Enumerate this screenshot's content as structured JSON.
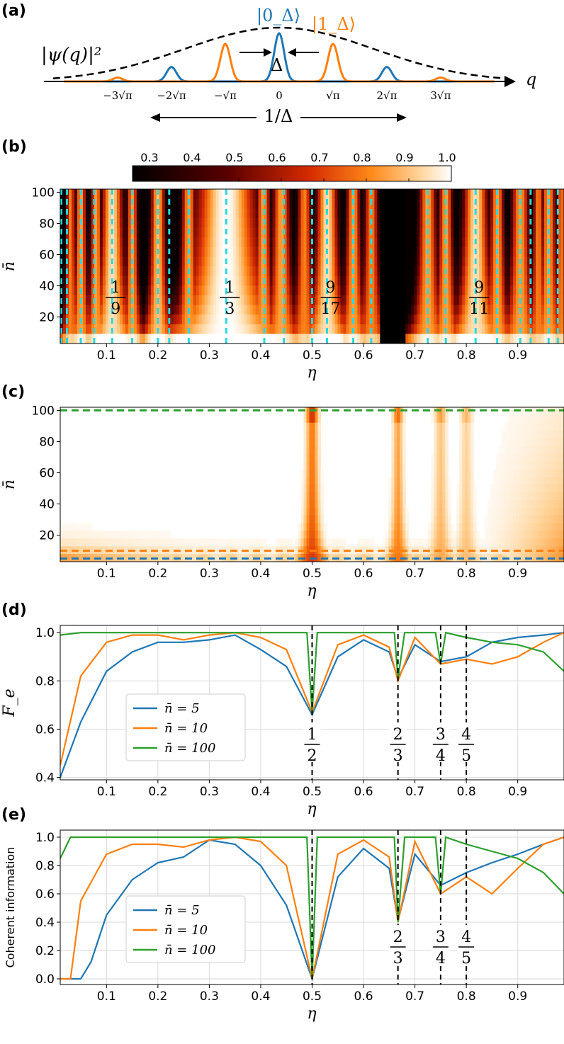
{
  "panels": {
    "a": {
      "label": "(a)",
      "y_label": "|ψ(q)|²",
      "axis_label": "q",
      "state0_label": "|0_Δ⟩",
      "state1_label": "|1_Δ⟩",
      "delta_label": "Δ",
      "width_label": "1/Δ",
      "ticks": [
        "−3√π",
        "−2√π",
        "−√π",
        "0",
        "√π",
        "2√π",
        "3√π"
      ],
      "colors": {
        "state0": "#1f77b4",
        "state1": "#ff7f0e",
        "envelope": "#000000"
      }
    },
    "b": {
      "label": "(b)",
      "colorbar_ticks": [
        "0.3",
        "0.4",
        "0.5",
        "0.6",
        "0.7",
        "0.8",
        "0.9",
        "1.0"
      ],
      "xlabel": "η",
      "ylabel": "n̄",
      "yticks": [
        "20",
        "40",
        "60",
        "80",
        "100"
      ],
      "xticks": [
        "0.1",
        "0.2",
        "0.3",
        "0.4",
        "0.5",
        "0.6",
        "0.7",
        "0.8",
        "0.9"
      ],
      "fractions": [
        {
          "num": "1",
          "den": "9",
          "eta": 0.111
        },
        {
          "num": "1",
          "den": "3",
          "eta": 0.333
        },
        {
          "num": "9",
          "den": "17",
          "eta": 0.529
        },
        {
          "num": "9",
          "den": "11",
          "eta": 0.818
        }
      ]
    },
    "c": {
      "label": "(c)",
      "xlabel": "η",
      "ylabel": "n̄",
      "yticks": [
        "20",
        "40",
        "60",
        "80",
        "100"
      ],
      "xticks": [
        "0.1",
        "0.2",
        "0.3",
        "0.4",
        "0.5",
        "0.6",
        "0.7",
        "0.8",
        "0.9"
      ],
      "hlines": [
        {
          "nbar": 100,
          "color": "#2ca02c"
        },
        {
          "nbar": 10,
          "color": "#ff7f0e"
        },
        {
          "nbar": 5,
          "color": "#1f77b4"
        }
      ]
    },
    "d": {
      "label": "(d)",
      "xlabel": "η",
      "ylabel": "F_e",
      "yticks": [
        "0.4",
        "0.6",
        "0.8",
        "1.0"
      ],
      "xticks": [
        "0.1",
        "0.2",
        "0.3",
        "0.4",
        "0.5",
        "0.6",
        "0.7",
        "0.8",
        "0.9"
      ],
      "legend": [
        "n̄ = 5",
        "n̄ = 10",
        "n̄ = 100"
      ],
      "fractions": [
        {
          "num": "1",
          "den": "2",
          "eta": 0.5
        },
        {
          "num": "2",
          "den": "3",
          "eta": 0.667
        },
        {
          "num": "3",
          "den": "4",
          "eta": 0.75
        },
        {
          "num": "4",
          "den": "5",
          "eta": 0.8
        }
      ]
    },
    "e": {
      "label": "(e)",
      "xlabel": "η",
      "ylabel": "Coherent information",
      "yticks": [
        "0.0",
        "0.2",
        "0.4",
        "0.6",
        "0.8",
        "1.0"
      ],
      "xticks": [
        "0.1",
        "0.2",
        "0.3",
        "0.4",
        "0.5",
        "0.6",
        "0.7",
        "0.8",
        "0.9"
      ],
      "legend": [
        "n̄ = 5",
        "n̄ = 10",
        "n̄ = 100"
      ],
      "fractions": [
        {
          "num": "2",
          "den": "3",
          "eta": 0.667
        },
        {
          "num": "3",
          "den": "4",
          "eta": 0.75
        },
        {
          "num": "4",
          "den": "5",
          "eta": 0.8
        }
      ]
    }
  },
  "series_colors": {
    "n5": "#1f77b4",
    "n10": "#ff7f0e",
    "n100": "#2ca02c"
  },
  "chart_data": [
    {
      "type": "line",
      "panel": "a",
      "title": "",
      "description_x": "q in units of √π",
      "series": [
        {
          "name": "|0_Δ⟩",
          "peaks_x": [
            -2,
            0,
            2
          ],
          "peak_heights": [
            0.3,
            1.0,
            0.3
          ]
        },
        {
          "name": "|1_Δ⟩",
          "peaks_x": [
            -3,
            -1,
            1,
            3
          ],
          "peak_heights": [
            0.08,
            0.78,
            0.78,
            0.08
          ]
        }
      ]
    },
    {
      "type": "heatmap",
      "panel": "b",
      "xlabel": "η",
      "ylabel": "n̄",
      "xlim": [
        0.01,
        0.99
      ],
      "ylim": [
        3,
        102
      ],
      "colorbar_range": [
        0.25,
        1.0
      ],
      "dashed_cyan_eta": [
        0.012,
        0.023,
        0.05,
        0.076,
        0.111,
        0.15,
        0.2,
        0.222,
        0.26,
        0.333,
        0.407,
        0.445,
        0.5,
        0.529,
        0.58,
        0.615,
        0.725,
        0.76,
        0.818,
        0.86,
        0.905,
        0.925,
        0.96,
        0.978
      ]
    },
    {
      "type": "heatmap",
      "panel": "c",
      "xlabel": "η",
      "ylabel": "n̄",
      "xlim": [
        0.01,
        0.99
      ],
      "ylim": [
        3,
        102
      ],
      "hlines_nbar": [
        100,
        10,
        5
      ]
    },
    {
      "type": "line",
      "panel": "d",
      "xlabel": "η",
      "ylabel": "F_e",
      "xlim": [
        0.01,
        0.99
      ],
      "ylim": [
        0.39,
        1.03
      ],
      "series": [
        {
          "name": "n̄ = 5",
          "x": [
            0.01,
            0.05,
            0.1,
            0.15,
            0.2,
            0.25,
            0.3,
            0.35,
            0.4,
            0.45,
            0.5,
            0.55,
            0.6,
            0.65,
            0.667,
            0.7,
            0.75,
            0.8,
            0.85,
            0.9,
            0.95,
            0.99
          ],
          "y": [
            0.4,
            0.63,
            0.84,
            0.92,
            0.96,
            0.96,
            0.97,
            0.99,
            0.93,
            0.86,
            0.66,
            0.9,
            0.97,
            0.92,
            0.81,
            0.95,
            0.88,
            0.9,
            0.96,
            0.98,
            0.99,
            1.0
          ]
        },
        {
          "name": "n̄ = 10",
          "x": [
            0.01,
            0.05,
            0.1,
            0.15,
            0.2,
            0.25,
            0.3,
            0.35,
            0.4,
            0.45,
            0.5,
            0.55,
            0.6,
            0.65,
            0.667,
            0.7,
            0.75,
            0.8,
            0.85,
            0.9,
            0.95,
            0.99
          ],
          "y": [
            0.45,
            0.82,
            0.96,
            0.99,
            0.99,
            0.97,
            0.99,
            1.0,
            0.98,
            0.93,
            0.67,
            0.95,
            0.99,
            0.94,
            0.8,
            0.98,
            0.87,
            0.89,
            0.87,
            0.9,
            0.96,
            1.0
          ]
        },
        {
          "name": "n̄ = 100",
          "x": [
            0.01,
            0.05,
            0.1,
            0.3,
            0.49,
            0.5,
            0.51,
            0.66,
            0.667,
            0.68,
            0.74,
            0.75,
            0.76,
            0.8,
            0.85,
            0.9,
            0.95,
            0.99
          ],
          "y": [
            0.99,
            1.0,
            1.0,
            1.0,
            1.0,
            0.67,
            1.0,
            1.0,
            0.81,
            1.0,
            1.0,
            0.87,
            1.0,
            0.98,
            0.96,
            0.95,
            0.92,
            0.84
          ]
        }
      ]
    },
    {
      "type": "line",
      "panel": "e",
      "xlabel": "η",
      "ylabel": "Coherent information",
      "xlim": [
        0.01,
        0.99
      ],
      "ylim": [
        -0.04,
        1.05
      ],
      "series": [
        {
          "name": "n̄ = 5",
          "x": [
            0.01,
            0.05,
            0.07,
            0.1,
            0.15,
            0.2,
            0.25,
            0.3,
            0.35,
            0.4,
            0.45,
            0.5,
            0.55,
            0.6,
            0.65,
            0.667,
            0.7,
            0.75,
            0.8,
            0.85,
            0.9,
            0.95,
            0.99
          ],
          "y": [
            0.0,
            0.0,
            0.12,
            0.45,
            0.7,
            0.82,
            0.86,
            0.98,
            0.95,
            0.8,
            0.52,
            0.0,
            0.72,
            0.92,
            0.78,
            0.41,
            0.88,
            0.66,
            0.75,
            0.82,
            0.88,
            0.95,
            1.0
          ]
        },
        {
          "name": "n̄ = 10",
          "x": [
            0.01,
            0.03,
            0.05,
            0.1,
            0.15,
            0.2,
            0.25,
            0.3,
            0.35,
            0.4,
            0.45,
            0.5,
            0.55,
            0.6,
            0.65,
            0.667,
            0.7,
            0.75,
            0.8,
            0.85,
            0.9,
            0.95,
            0.99
          ],
          "y": [
            0.0,
            0.0,
            0.55,
            0.88,
            0.95,
            0.95,
            0.93,
            0.98,
            1.0,
            0.97,
            0.8,
            0.0,
            0.88,
            0.98,
            0.86,
            0.4,
            0.97,
            0.6,
            0.72,
            0.6,
            0.78,
            0.95,
            1.0
          ]
        },
        {
          "name": "n̄ = 100",
          "x": [
            0.01,
            0.03,
            0.1,
            0.3,
            0.49,
            0.5,
            0.51,
            0.66,
            0.667,
            0.68,
            0.74,
            0.75,
            0.76,
            0.8,
            0.85,
            0.9,
            0.95,
            0.99
          ],
          "y": [
            0.85,
            1.0,
            1.0,
            1.0,
            1.0,
            0.0,
            1.0,
            1.0,
            0.4,
            1.0,
            1.0,
            0.6,
            1.0,
            0.95,
            0.9,
            0.85,
            0.75,
            0.6
          ]
        }
      ]
    }
  ]
}
